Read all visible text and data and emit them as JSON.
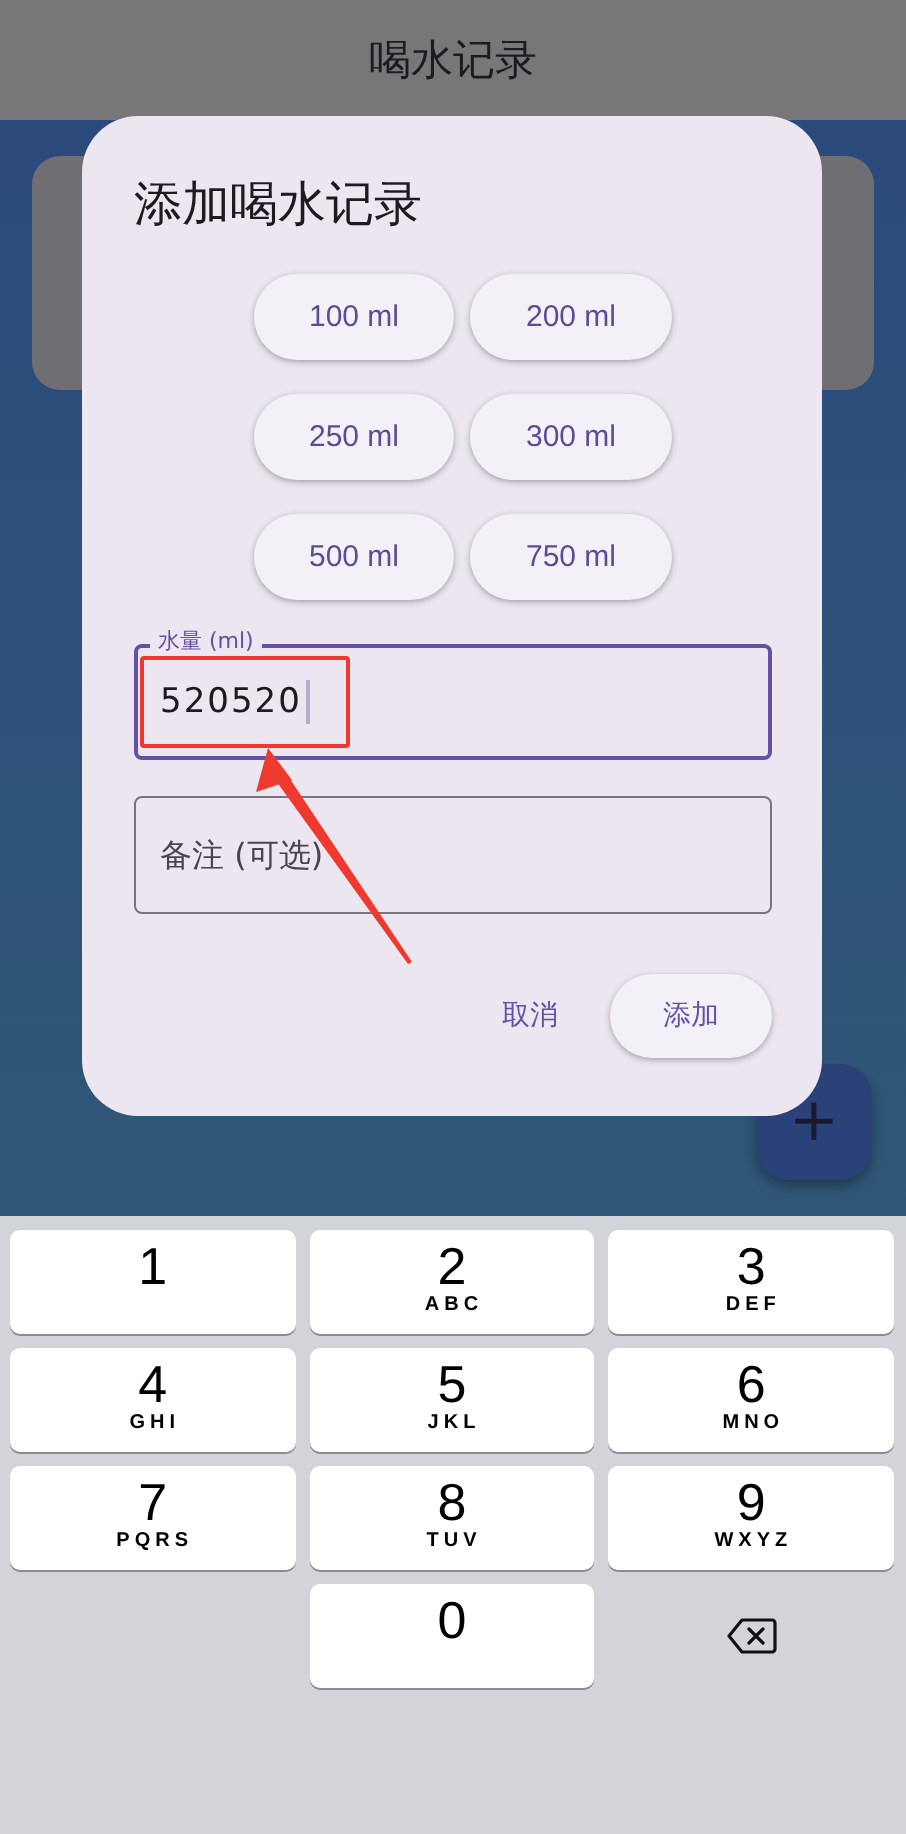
{
  "app_bar": {
    "title": "喝水记录"
  },
  "dialog": {
    "title": "添加喝水记录",
    "presets": [
      "100 ml",
      "200 ml",
      "250 ml",
      "300 ml",
      "500 ml",
      "750 ml"
    ],
    "amount_field": {
      "label": "水量 (ml)",
      "value": "520520",
      "focused": true
    },
    "note_field": {
      "placeholder": "备注 (可选)"
    },
    "actions": {
      "cancel": "取消",
      "confirm": "添加"
    }
  },
  "fab": {
    "label": "+"
  },
  "keypad": [
    {
      "kind": "digit",
      "digit": "1"
    },
    {
      "kind": "digit",
      "digit": "2",
      "letters": "ABC"
    },
    {
      "kind": "digit",
      "digit": "3",
      "letters": "DEF"
    },
    {
      "kind": "digit",
      "digit": "4",
      "letters": "GHI"
    },
    {
      "kind": "digit",
      "digit": "5",
      "letters": "JKL"
    },
    {
      "kind": "digit",
      "digit": "6",
      "letters": "MNO"
    },
    {
      "kind": "digit",
      "digit": "7",
      "letters": "PQRS"
    },
    {
      "kind": "digit",
      "digit": "8",
      "letters": "TUV"
    },
    {
      "kind": "digit",
      "digit": "9",
      "letters": "WXYZ"
    },
    {
      "kind": "blank"
    },
    {
      "kind": "digit",
      "digit": "0"
    },
    {
      "kind": "backspace"
    }
  ]
}
